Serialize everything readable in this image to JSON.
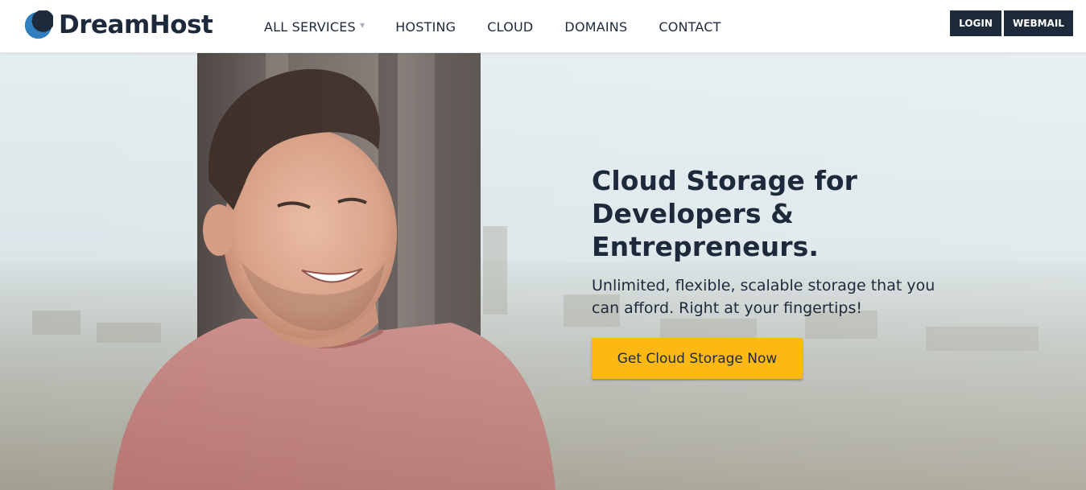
{
  "brand": {
    "name": "DreamHost",
    "logo_icon": "dreamhost-moon-logo-icon",
    "color_primary": "#1d2a3b",
    "color_accent": "#2f7fc1",
    "color_cta": "#fdb813"
  },
  "nav": {
    "items": [
      {
        "label": "ALL SERVICES",
        "has_dropdown": true,
        "dropdown_icon": "caret-down-icon"
      },
      {
        "label": "HOSTING"
      },
      {
        "label": "CLOUD"
      },
      {
        "label": "DOMAINS"
      },
      {
        "label": "CONTACT"
      }
    ]
  },
  "account": {
    "login_label": "LOGIN",
    "webmail_label": "WEBMAIL"
  },
  "hero": {
    "heading_lines": [
      "Cloud Storage for",
      "Developers &",
      "Entrepreneurs."
    ],
    "subtext_lines": [
      "Unlimited, flexible, scalable storage that you",
      "can afford. Right at your fingertips!"
    ],
    "cta_label": "Get Cloud Storage Now",
    "image": "smiling-man-red-tshirt-city-window-photo"
  }
}
